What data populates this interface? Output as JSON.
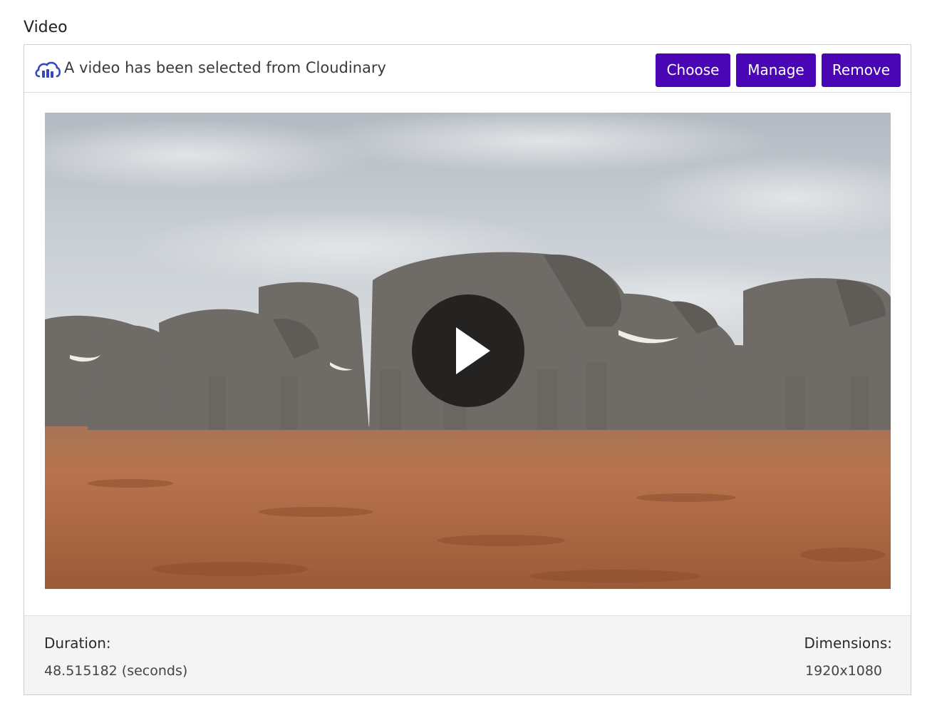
{
  "field": {
    "label": "Video"
  },
  "header": {
    "icon": "cloudinary-cloud-icon",
    "status_text": "A video has been selected from Cloudinary",
    "buttons": {
      "choose": "Choose",
      "manage": "Manage",
      "remove": "Remove"
    }
  },
  "video": {
    "thumbnail": "elephant-herd-walking",
    "play_icon": "play-icon"
  },
  "footer": {
    "duration_label": "Duration:",
    "duration_value": "48.515182 (seconds)",
    "dimensions_label": "Dimensions:",
    "dimensions_value": "1920x1080"
  },
  "colors": {
    "button_bg": "#4a06b5",
    "button_text": "#ffffff",
    "cloud_icon": "#3448c5",
    "footer_bg": "#f4f4f4"
  }
}
